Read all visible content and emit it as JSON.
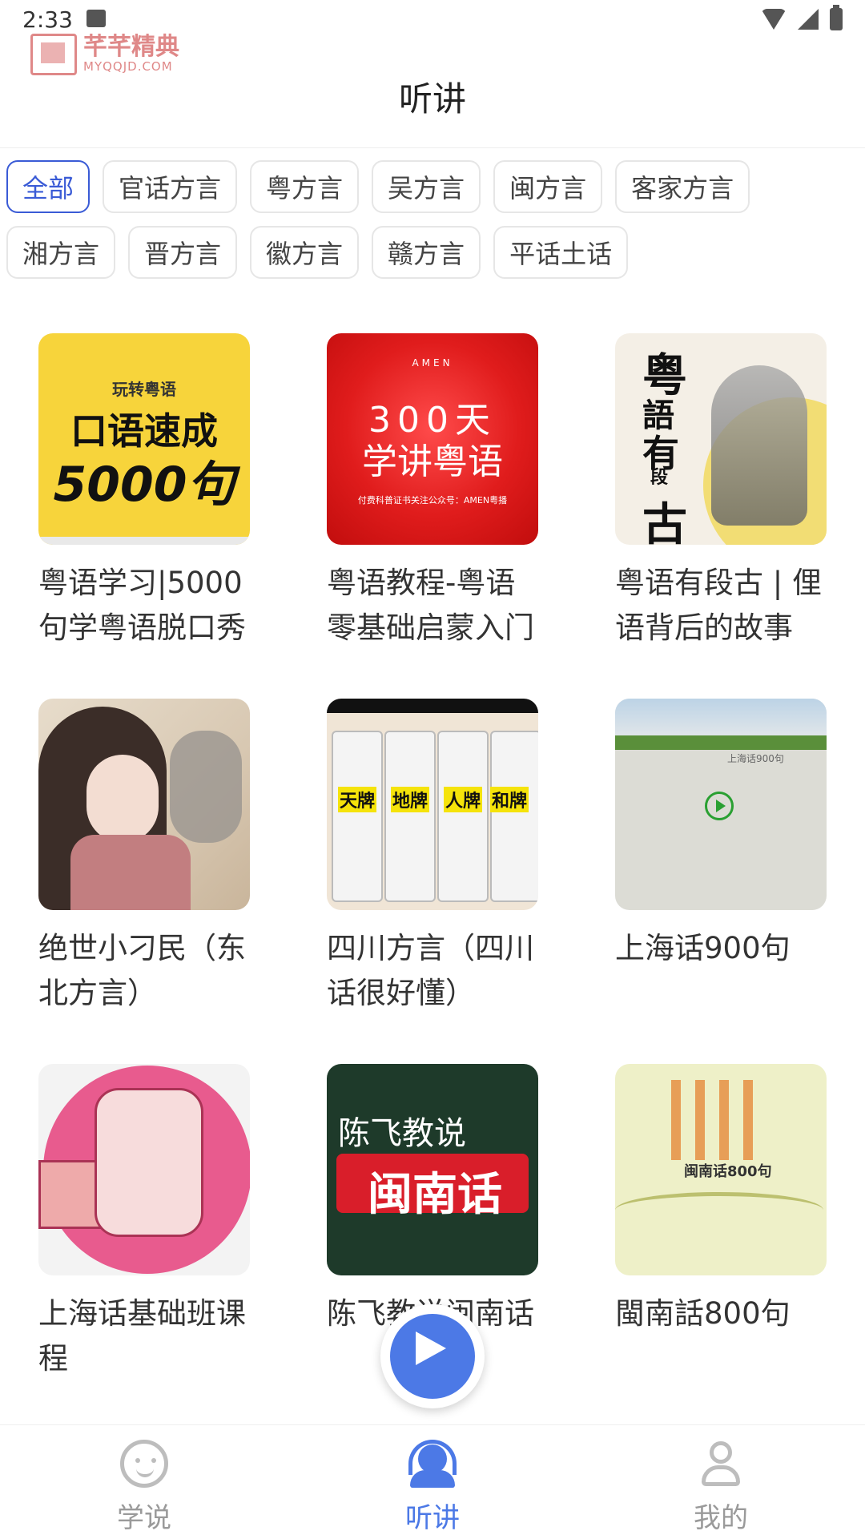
{
  "status_bar": {
    "time": "2:33"
  },
  "watermark": {
    "name": "芊芊精典",
    "url": "MYQQJD.COM"
  },
  "header": {
    "title": "听讲"
  },
  "filters": [
    {
      "label": "全部",
      "active": true
    },
    {
      "label": "官话方言"
    },
    {
      "label": "粤方言"
    },
    {
      "label": "吴方言"
    },
    {
      "label": "闽方言"
    },
    {
      "label": "客家方言"
    },
    {
      "label": "湘方言"
    },
    {
      "label": "晋方言"
    },
    {
      "label": "徽方言"
    },
    {
      "label": "赣方言"
    },
    {
      "label": "平话土话"
    }
  ],
  "cards": [
    {
      "title": "粤语学习|5000句学粤语脱口秀",
      "cover": {
        "line1": "玩转粤语",
        "line2": "口语速成",
        "line3": "5000句"
      }
    },
    {
      "title": "粤语教程-粤语零基础启蒙入门",
      "cover": {
        "top": "AMEN",
        "line1": "300天",
        "line2": "学讲粤语",
        "foot": "付费科普证书关注公众号：AMEN粤播"
      }
    },
    {
      "title": "粤语有段古 | 俚语背后的故事",
      "cover": {
        "c1": "粤",
        "c2": "語",
        "c3": "有",
        "c4": "段",
        "c5": "古"
      }
    },
    {
      "title": "绝世小刁民（东北方言）",
      "cover": {}
    },
    {
      "title": "四川方言（四川话很好懂）",
      "cover": {
        "l1": "天牌",
        "l2": "地牌",
        "l3": "人牌",
        "l4": "和牌"
      }
    },
    {
      "title": "上海话900句",
      "cover": {
        "caption": "上海话900句"
      }
    },
    {
      "title": "上海话基础班课程",
      "cover": {}
    },
    {
      "title": "陈飞教说闽南话",
      "cover": {
        "line1": "陈飞教说",
        "line2": "闽南话"
      }
    },
    {
      "title": "閩南話800句",
      "cover": {
        "title": "闽南话800句"
      }
    }
  ],
  "bottom_nav": [
    {
      "label": "学说",
      "icon": "chat-face-icon",
      "active": false
    },
    {
      "label": "听讲",
      "icon": "headphones-user-icon",
      "active": true
    },
    {
      "label": "我的",
      "icon": "user-icon",
      "active": false
    }
  ],
  "colors": {
    "accent": "#4c79e6",
    "chip_active": "#3a5bd6"
  }
}
